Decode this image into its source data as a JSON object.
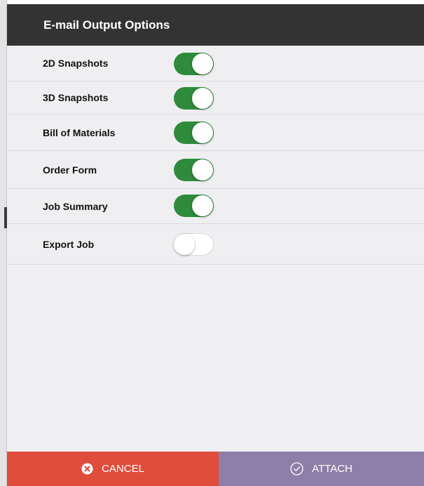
{
  "dialog": {
    "title": "E-mail Output Options"
  },
  "options": [
    {
      "label": "2D Snapshots",
      "enabled": true
    },
    {
      "label": "3D Snapshots",
      "enabled": true
    },
    {
      "label": "Bill of Materials",
      "enabled": true
    },
    {
      "label": "Order Form",
      "enabled": true
    },
    {
      "label": "Job Summary",
      "enabled": true
    },
    {
      "label": "Export Job",
      "enabled": false
    }
  ],
  "footer": {
    "cancel_label": "CANCEL",
    "cancel_icon": "cancel-circle-icon",
    "attach_label": "ATTACH",
    "attach_icon": "check-circle-icon"
  },
  "colors": {
    "title_bar": "#333333",
    "toggle_on": "#2e8b3c",
    "cancel": "#e04d3c",
    "attach": "#8e7fa8",
    "panel": "#efeff2"
  }
}
